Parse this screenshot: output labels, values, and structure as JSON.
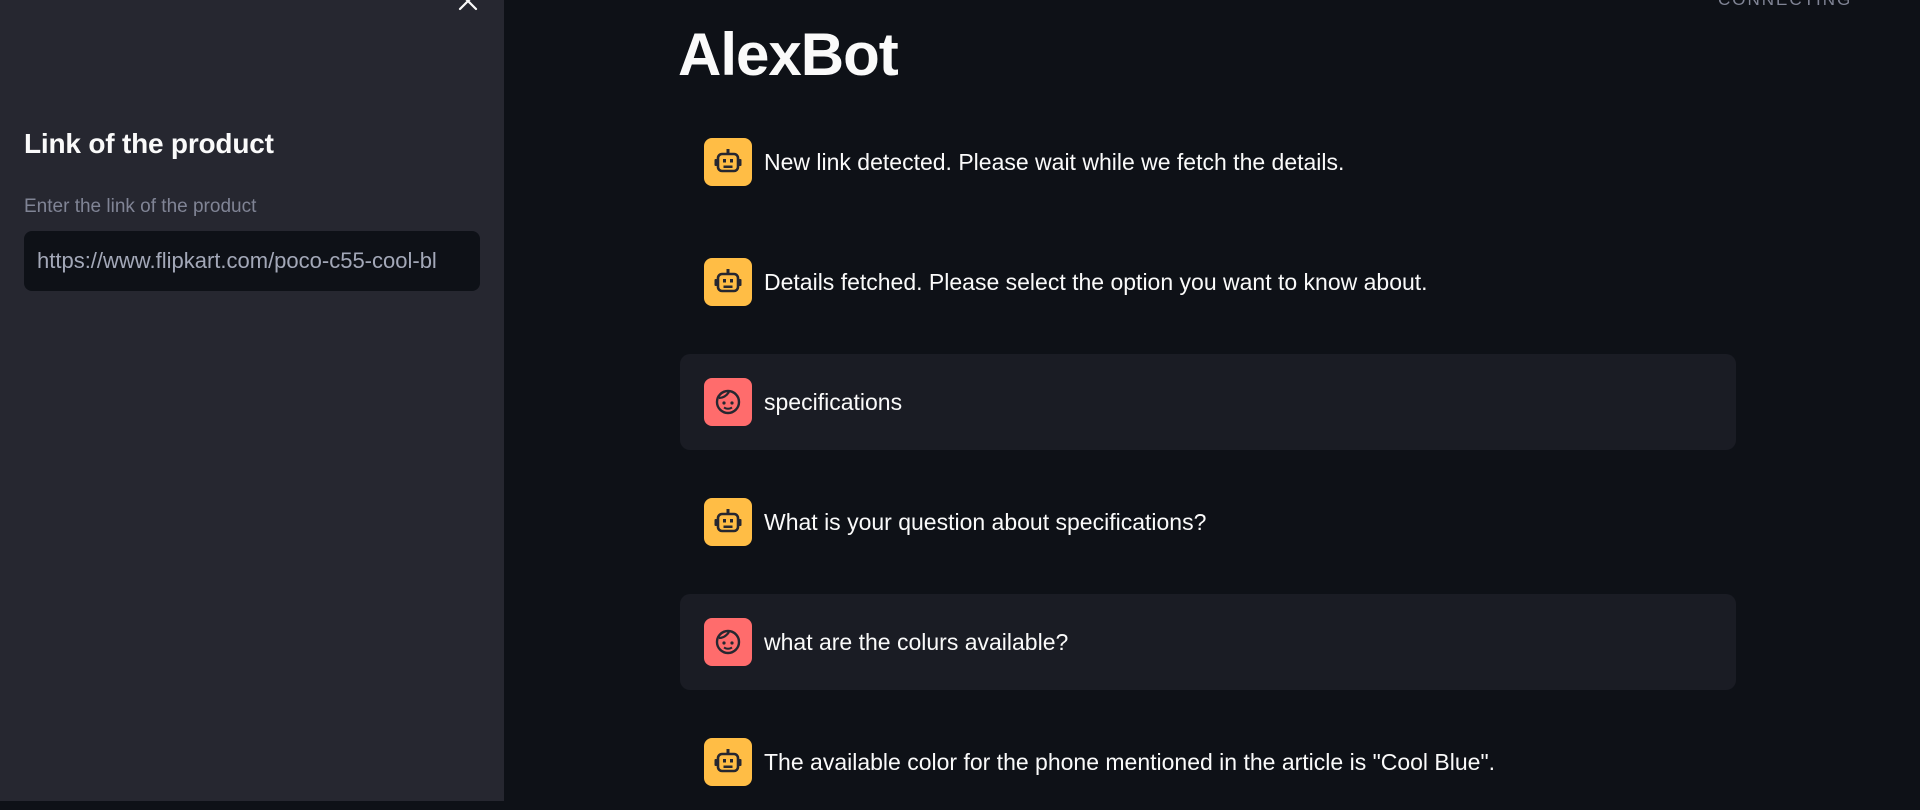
{
  "sidebar": {
    "heading": "Link of the product",
    "input_label": "Enter the link of the product",
    "input_value": "https://www.flipkart.com/poco-c55-cool-bl"
  },
  "header": {
    "status": "CONNECTING"
  },
  "main": {
    "title": "AlexBot",
    "messages": [
      {
        "role": "assistant",
        "avatar_icon": "robot-icon",
        "text": "New link detected. Please wait while we fetch the details."
      },
      {
        "role": "assistant",
        "avatar_icon": "robot-icon",
        "text": "Details fetched. Please select the option you want to know about."
      },
      {
        "role": "user",
        "avatar_icon": "user-face-icon",
        "text": "specifications"
      },
      {
        "role": "assistant",
        "avatar_icon": "robot-icon",
        "text": "What is your question about specifications?"
      },
      {
        "role": "user",
        "avatar_icon": "user-face-icon",
        "text": "what are the colurs available?"
      },
      {
        "role": "assistant",
        "avatar_icon": "robot-icon",
        "text": "The available color for the phone mentioned in the article is \"Cool Blue\"."
      }
    ]
  },
  "colors": {
    "background": "#0e1117",
    "sidebar": "#262730",
    "bot_avatar": "#ffbd45",
    "user_avatar": "#ff6c6c",
    "user_message_bg": "#1a1c24"
  }
}
